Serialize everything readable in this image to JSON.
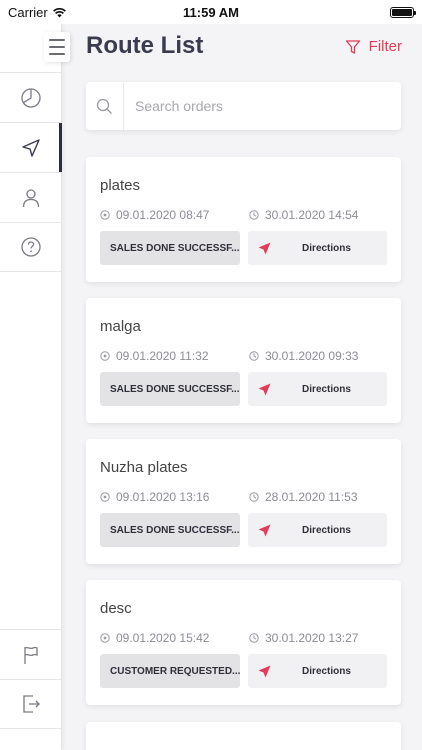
{
  "status_bar": {
    "carrier": "Carrier",
    "time": "11:59 AM"
  },
  "header": {
    "title": "Route List",
    "filter_label": "Filter"
  },
  "sidebar": {
    "items": [
      {
        "icon": "pie-chart-icon"
      },
      {
        "icon": "navigation-arrow-icon",
        "active": true
      },
      {
        "icon": "user-icon"
      },
      {
        "icon": "help-icon"
      }
    ],
    "bottom_items": [
      {
        "icon": "flag-icon"
      },
      {
        "icon": "logout-icon"
      }
    ]
  },
  "search": {
    "placeholder": "Search orders",
    "value": ""
  },
  "orders": [
    {
      "name": "plates",
      "start": "09.01.2020 08:47",
      "end": "30.01.2020 14:54",
      "status": "SALES DONE SUCCESSF...",
      "action": "Directions"
    },
    {
      "name": "malga",
      "start": "09.01.2020 11:32",
      "end": "30.01.2020 09:33",
      "status": "SALES DONE SUCCESSF...",
      "action": "Directions"
    },
    {
      "name": "Nuzha plates",
      "start": "09.01.2020 13:16",
      "end": "28.01.2020 11:53",
      "status": "SALES DONE SUCCESSF...",
      "action": "Directions"
    },
    {
      "name": "desc",
      "start": "09.01.2020 15:42",
      "end": "30.01.2020 13:27",
      "status": "CUSTOMER REQUESTED...",
      "action": "Directions"
    }
  ],
  "colors": {
    "accent": "#e23c5a",
    "title": "#3a3b4f",
    "sidebar_active": "#2c2d40",
    "chip_bg": "#e3e3e6"
  }
}
